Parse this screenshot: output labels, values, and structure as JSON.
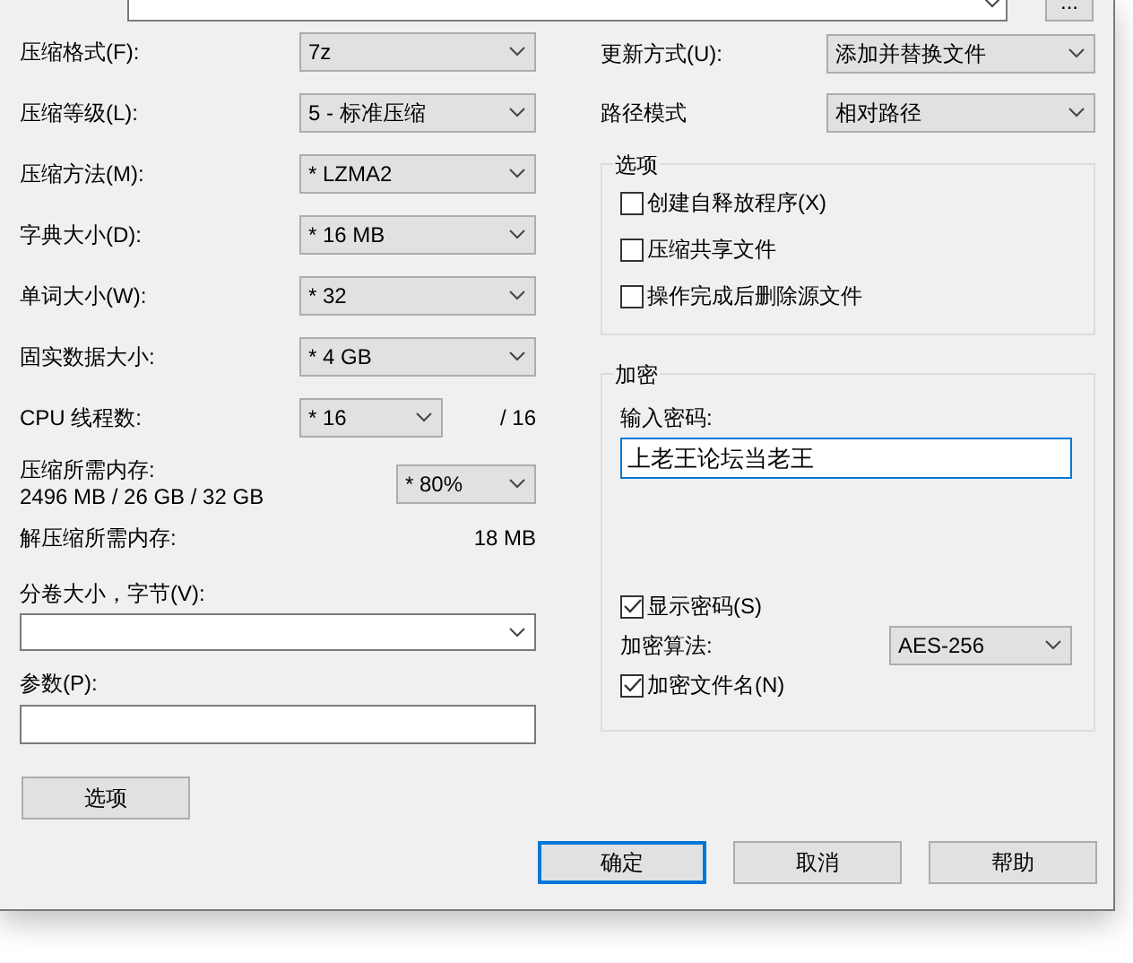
{
  "archive_path": {
    "browse_button": "..."
  },
  "left_settings": [
    {
      "label": "压缩格式(F):",
      "value": "7z"
    },
    {
      "label": "压缩等级(L):",
      "value": "5 - 标准压缩"
    },
    {
      "label": "压缩方法(M):",
      "value": "* LZMA2"
    },
    {
      "label": "字典大小(D):",
      "value": "* 16 MB"
    },
    {
      "label": "单词大小(W):",
      "value": "* 32"
    },
    {
      "label": "固实数据大小:",
      "value": "* 4 GB"
    }
  ],
  "cpu_threads": {
    "label": "CPU 线程数:",
    "value": "* 16",
    "max": "/ 16"
  },
  "compression_memory": {
    "label": "压缩所需内存:",
    "detail": "2496 MB / 26 GB / 32 GB",
    "value": "* 80%"
  },
  "decompression_memory": {
    "label": "解压缩所需内存:",
    "value": "18 MB"
  },
  "volume_size": {
    "label": "分卷大小，字节(V):"
  },
  "parameters": {
    "label": "参数(P):"
  },
  "options_button": "选项",
  "update_mode": {
    "label": "更新方式(U):",
    "value": "添加并替换文件"
  },
  "path_mode": {
    "label": "路径模式",
    "value": "相对路径"
  },
  "options_group": {
    "title": "选项",
    "checkboxes": [
      {
        "label": "创建自释放程序(X)",
        "checked": false
      },
      {
        "label": "压缩共享文件",
        "checked": false
      },
      {
        "label": "操作完成后删除源文件",
        "checked": false
      }
    ]
  },
  "encryption": {
    "title": "加密",
    "password_label": "输入密码:",
    "password": "上老王论坛当老王",
    "show_password": {
      "label": "显示密码(S)",
      "checked": true
    },
    "method": {
      "label": "加密算法:",
      "value": "AES-256"
    },
    "encrypt_file_names": {
      "label": "加密文件名(N)",
      "checked": true
    }
  },
  "buttons": [
    {
      "label": "确定",
      "default": true
    },
    {
      "label": "取消",
      "default": false
    },
    {
      "label": "帮助",
      "default": false
    }
  ]
}
